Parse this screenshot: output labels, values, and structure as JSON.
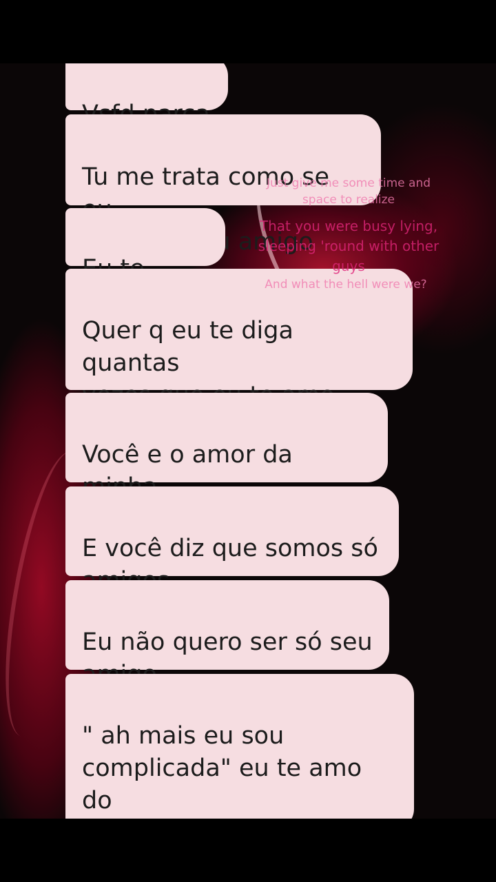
{
  "messages": [
    {
      "text": "Vsfd parça"
    },
    {
      "text": "Tu me trata como se eu\nfosse só seu amigo"
    },
    {
      "text": "Eu te amo!"
    },
    {
      "text": "Quer q eu te diga quantas\nvezes que eu te amo\nmaluca?"
    },
    {
      "text": "Você e o amor da minha\nvida"
    },
    {
      "text": "E você diz que somos só\namigos"
    },
    {
      "text": "Eu não quero ser só seu\namigo"
    },
    {
      "text": "\" ah mais eu sou\ncomplicada\" eu te amo do\ntamanho da sua\ncomplicação garota!"
    }
  ],
  "lyrics_overlay": {
    "line1": "Just give me some time and\nspace to realize",
    "line2": "That you were busy lying,\nsleeping 'round with other\nguys",
    "line3": "And what the hell were we?"
  },
  "colors": {
    "bubble_bg": "#f6dde1",
    "bubble_text": "#1c1c1c",
    "overlay_text": "#e0267a",
    "background": "#0b0607",
    "accent_red": "#b0102e"
  }
}
